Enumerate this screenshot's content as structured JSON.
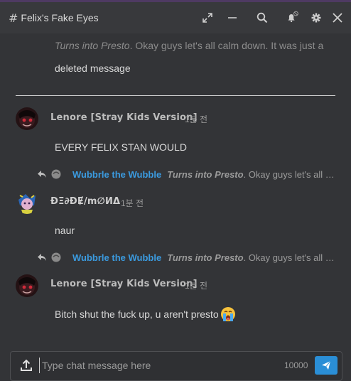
{
  "header": {
    "hash": "#",
    "title": "Felix's Fake Eyes"
  },
  "messages": [
    {
      "quote_label": "Turns into Presto",
      "text_line1": ". Okay guys let's all calm down. It was just a",
      "text_line2": "deleted message"
    },
    {
      "author": "Lenore [Stray Kids Version]",
      "time": "1분 전",
      "text": "EVERY FELIX STAN WOULD",
      "reply": {
        "author": "Wubbrle the Wubble",
        "quote": "Turns into Presto",
        "rest": ". Okay guys let's all calm down. It was just a deleted message"
      }
    },
    {
      "author": "ÐΞ∂ÐɆ/m∅ИΔ",
      "time": "1분 전",
      "text": "naur",
      "reply": {
        "author": "Wubbrle the Wubble",
        "quote": "Turns into Presto",
        "rest": ". Okay guys let's all calm down. It was just a deleted message"
      }
    },
    {
      "author": "Lenore [Stray Kids Version]",
      "time": "1분 전",
      "text": "Bitch shut the fuck up, u aren't presto",
      "emoji": "crying-face-emoji"
    }
  ],
  "composer": {
    "placeholder": "Type chat message here",
    "counter": "10000"
  },
  "icons": {
    "expand": "expand-icon",
    "minimize": "minimize-icon",
    "search": "search-icon",
    "bell": "bell-muted-icon",
    "settings": "gear-icon",
    "close": "close-icon",
    "upload": "upload-icon",
    "send": "send-icon",
    "reply": "reply-arrow-icon",
    "emoji_react": "emoji-react-icon"
  },
  "colors": {
    "background": "#333437",
    "header": "#38393c",
    "accent": "#2a8ed6",
    "link": "#3b9be0"
  }
}
